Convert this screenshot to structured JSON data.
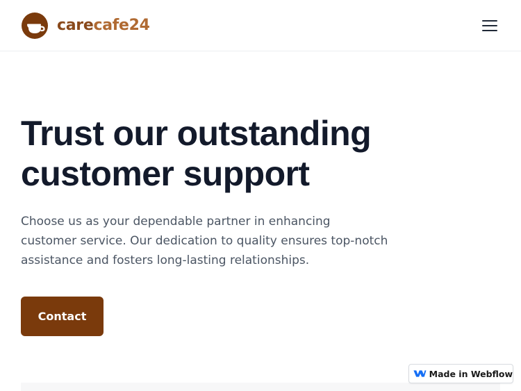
{
  "header": {
    "logo_part1": "care",
    "logo_part2": "cafe24",
    "menu_icon": "hamburger-menu-icon"
  },
  "hero": {
    "title_line1": "Trust our outstanding",
    "title_line2": "customer support",
    "description": "Choose us as your dependable partner in enhancing customer service. Our dedication to quality ensures top-notch assistance and fosters long-lasting relationships.",
    "cta_label": "Contact"
  },
  "badge": {
    "label": "Made in Webflow",
    "icon": "webflow-logo-icon"
  },
  "colors": {
    "brand_brown": "#7a3a0c",
    "logo_care": "#8a4a1c",
    "logo_cafe": "#b06a32",
    "heading": "#131a2b",
    "body_text": "#4b5563",
    "webflow_blue": "#146ef5"
  }
}
